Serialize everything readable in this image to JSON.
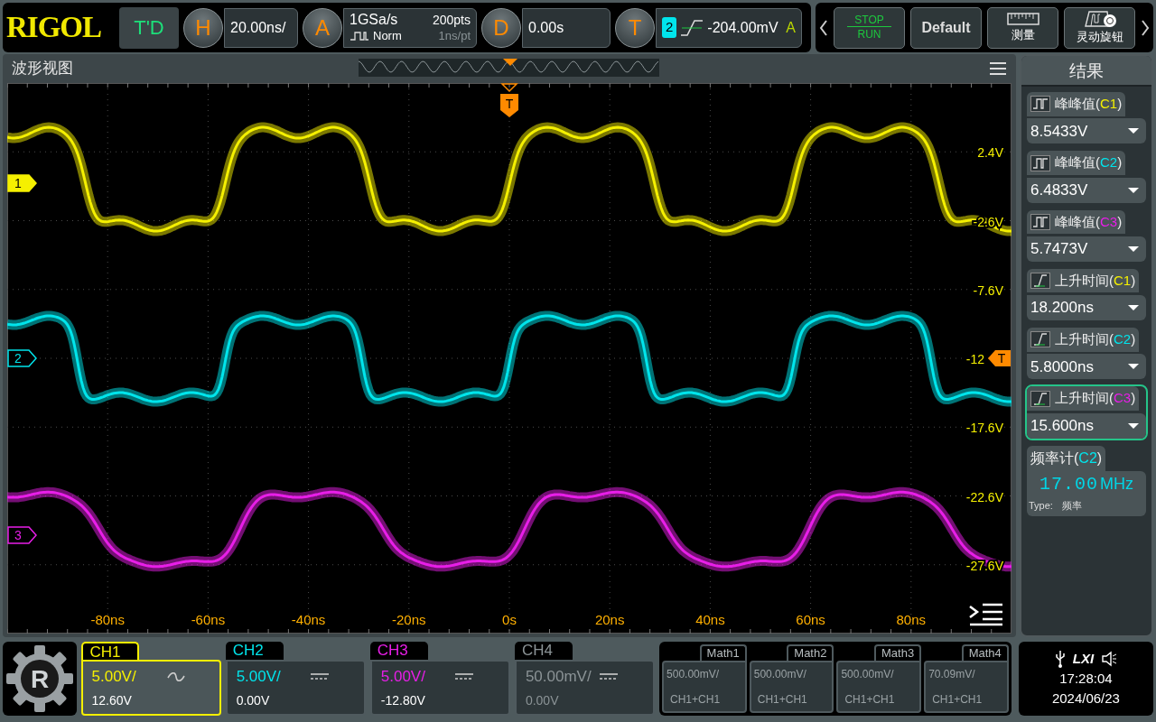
{
  "header": {
    "logo": "RIGOL",
    "mode": "T'D",
    "horizontal": {
      "key": "H",
      "scale": "20.00ns/"
    },
    "acquire": {
      "key": "A",
      "rate": "1GSa/s",
      "mode": "Norm",
      "points": "200pts",
      "resolution": "1ns/pt"
    },
    "delay": {
      "key": "D",
      "value": "0.00s"
    },
    "trigger": {
      "key": "T",
      "source": "2",
      "level": "-204.00mV",
      "sweep": "A"
    }
  },
  "toolbar": [
    {
      "kind": "runstop",
      "top": "STOP",
      "bottom": "RUN"
    },
    {
      "kind": "default",
      "label": "Default"
    },
    {
      "kind": "measure",
      "label": "测量"
    },
    {
      "kind": "knob",
      "label": "灵动旋钮"
    }
  ],
  "waveform": {
    "title": "波形视图",
    "x_labels": [
      "-80ns",
      "-60ns",
      "-40ns",
      "-20ns",
      "0s",
      "20ns",
      "40ns",
      "60ns",
      "80ns"
    ],
    "y_labels": [
      "2.4V",
      "-2.6V",
      "-7.6V",
      "-12",
      "-17.6V",
      "-22.6V",
      "-27.6V"
    ],
    "channel_markers": [
      {
        "label": "1",
        "color": "#f5f000",
        "selected": true
      },
      {
        "label": "2",
        "color": "#00e5ec",
        "selected": false
      },
      {
        "label": "3",
        "color": "#e81ee8",
        "selected": false
      }
    ],
    "trigger_top": {
      "label": "T"
    },
    "trigger_right": {
      "label": "T"
    }
  },
  "results": {
    "title": "结果",
    "items": [
      {
        "kind": "amplitude",
        "label": "峰峰值(",
        "source": "C1",
        "close": ")",
        "color": "#f5f000",
        "value": "8.5433V",
        "selected": false
      },
      {
        "kind": "amplitude",
        "label": "峰峰值(",
        "source": "C2",
        "close": ")",
        "color": "#00e5ec",
        "value": "6.4833V",
        "selected": false
      },
      {
        "kind": "amplitude",
        "label": "峰峰值(",
        "source": "C3",
        "close": ")",
        "color": "#e81ee8",
        "value": "5.7473V",
        "selected": false
      },
      {
        "kind": "rise",
        "label": "上升时间(",
        "source": "C1",
        "close": ")",
        "color": "#f5f000",
        "value": "18.200ns",
        "selected": false
      },
      {
        "kind": "rise",
        "label": "上升时间(",
        "source": "C2",
        "close": ")",
        "color": "#00e5ec",
        "value": "5.8000ns",
        "selected": false
      },
      {
        "kind": "rise",
        "label": "上升时间(",
        "source": "C3",
        "close": ")",
        "color": "#e81ee8",
        "value": "15.600ns",
        "selected": true
      }
    ],
    "counter": {
      "label": "频率计(",
      "source": "C2",
      "close": ")",
      "color": "#00e5ec",
      "value": "17.00",
      "unit": "MHz",
      "type_label": "Type:",
      "type": "频率"
    }
  },
  "logo_letter": "R",
  "channels": [
    {
      "name": "CH1",
      "scale": "5.00V/",
      "offset": "12.60V",
      "kind": "ac",
      "selected": true,
      "enabled": true
    },
    {
      "name": "CH2",
      "scale": "5.00V/",
      "offset": "0.00V",
      "kind": "dc",
      "selected": false,
      "enabled": true
    },
    {
      "name": "CH3",
      "scale": "5.00V/",
      "offset": "-12.80V",
      "kind": "dc",
      "selected": false,
      "enabled": true
    },
    {
      "name": "CH4",
      "scale": "50.00mV/",
      "offset": "0.00V",
      "kind": "dc",
      "selected": false,
      "enabled": false
    }
  ],
  "math": [
    {
      "name": "Math1",
      "scale": "500.00mV/",
      "source": "CH1+CH1"
    },
    {
      "name": "Math2",
      "scale": "500.00mV/",
      "source": "CH1+CH1"
    },
    {
      "name": "Math3",
      "scale": "500.00mV/",
      "source": "CH1+CH1"
    },
    {
      "name": "Math4",
      "scale": "70.09mV/",
      "source": "CH1+CH1"
    }
  ],
  "status": {
    "lxi": "LXI",
    "time": "17:28:04",
    "date": "2024/06/23"
  }
}
